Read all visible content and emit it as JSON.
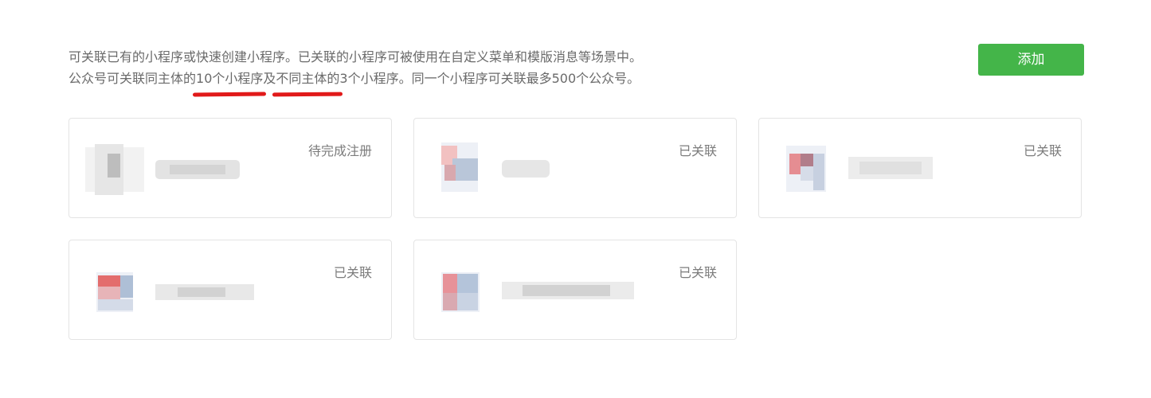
{
  "intro": {
    "line1": "可关联已有的小程序或快速创建小程序。已关联的小程序可被使用在自定义菜单和模版消息等场景中。",
    "line2": {
      "part1": "公众号可关联同主体的",
      "highlight1": "10个小程序",
      "part2": "及",
      "highlight2": "不同主体的",
      "part3": "3个小程序。同一个小程序可关联最多500个公众号。"
    }
  },
  "add_button": {
    "label": "添加"
  },
  "accent_color": "#44b549",
  "cards": [
    {
      "status": "待完成注册",
      "avatar_icon": "miniprogram-avatar-icon"
    },
    {
      "status": "已关联",
      "avatar_icon": "miniprogram-avatar-icon"
    },
    {
      "status": "已关联",
      "avatar_icon": "miniprogram-avatar-icon"
    },
    {
      "status": "已关联",
      "avatar_icon": "miniprogram-avatar-icon"
    },
    {
      "status": "已关联",
      "avatar_icon": "miniprogram-avatar-icon"
    }
  ]
}
